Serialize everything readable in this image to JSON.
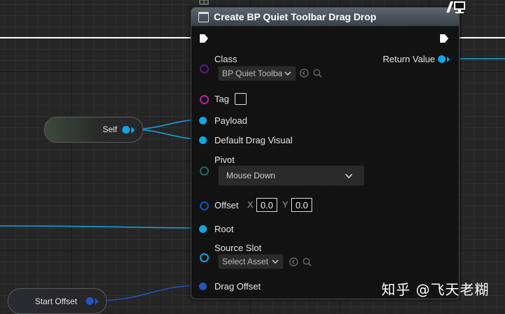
{
  "node": {
    "title": "Create BP Quiet Toolbar Drag Drop",
    "icon": "function-icon",
    "header_color": "#4b525c",
    "pins_left": {
      "class_label": "Class",
      "class_value": "BP Quiet Toolba",
      "tag_label": "Tag",
      "payload_label": "Payload",
      "default_drag_visual_label": "Default Drag Visual",
      "pivot_label": "Pivot",
      "pivot_value": "Mouse Down",
      "offset_label": "Offset",
      "offset_x_axis": "X",
      "offset_x_value": "0.0",
      "offset_y_axis": "Y",
      "offset_y_value": "0.0",
      "root_label": "Root",
      "source_slot_label": "Source Slot",
      "source_slot_value": "Select Asset",
      "drag_offset_label": "Drag Offset"
    },
    "pins_right": {
      "return_value_label": "Return Value"
    }
  },
  "self_node": {
    "label": "Self"
  },
  "start_offset_node": {
    "label": "Start Offset"
  },
  "watermark": "知乎 @飞天老糊",
  "colors": {
    "object_pin": "#0ea5e6",
    "class_pin": "#5b1a8a",
    "tag_pin": "#c020a0",
    "enum_pin": "#1a6e66",
    "struct_pin": "#0e58c0",
    "wire": "#0ea5e6",
    "exec_wire": "#ffffff"
  }
}
